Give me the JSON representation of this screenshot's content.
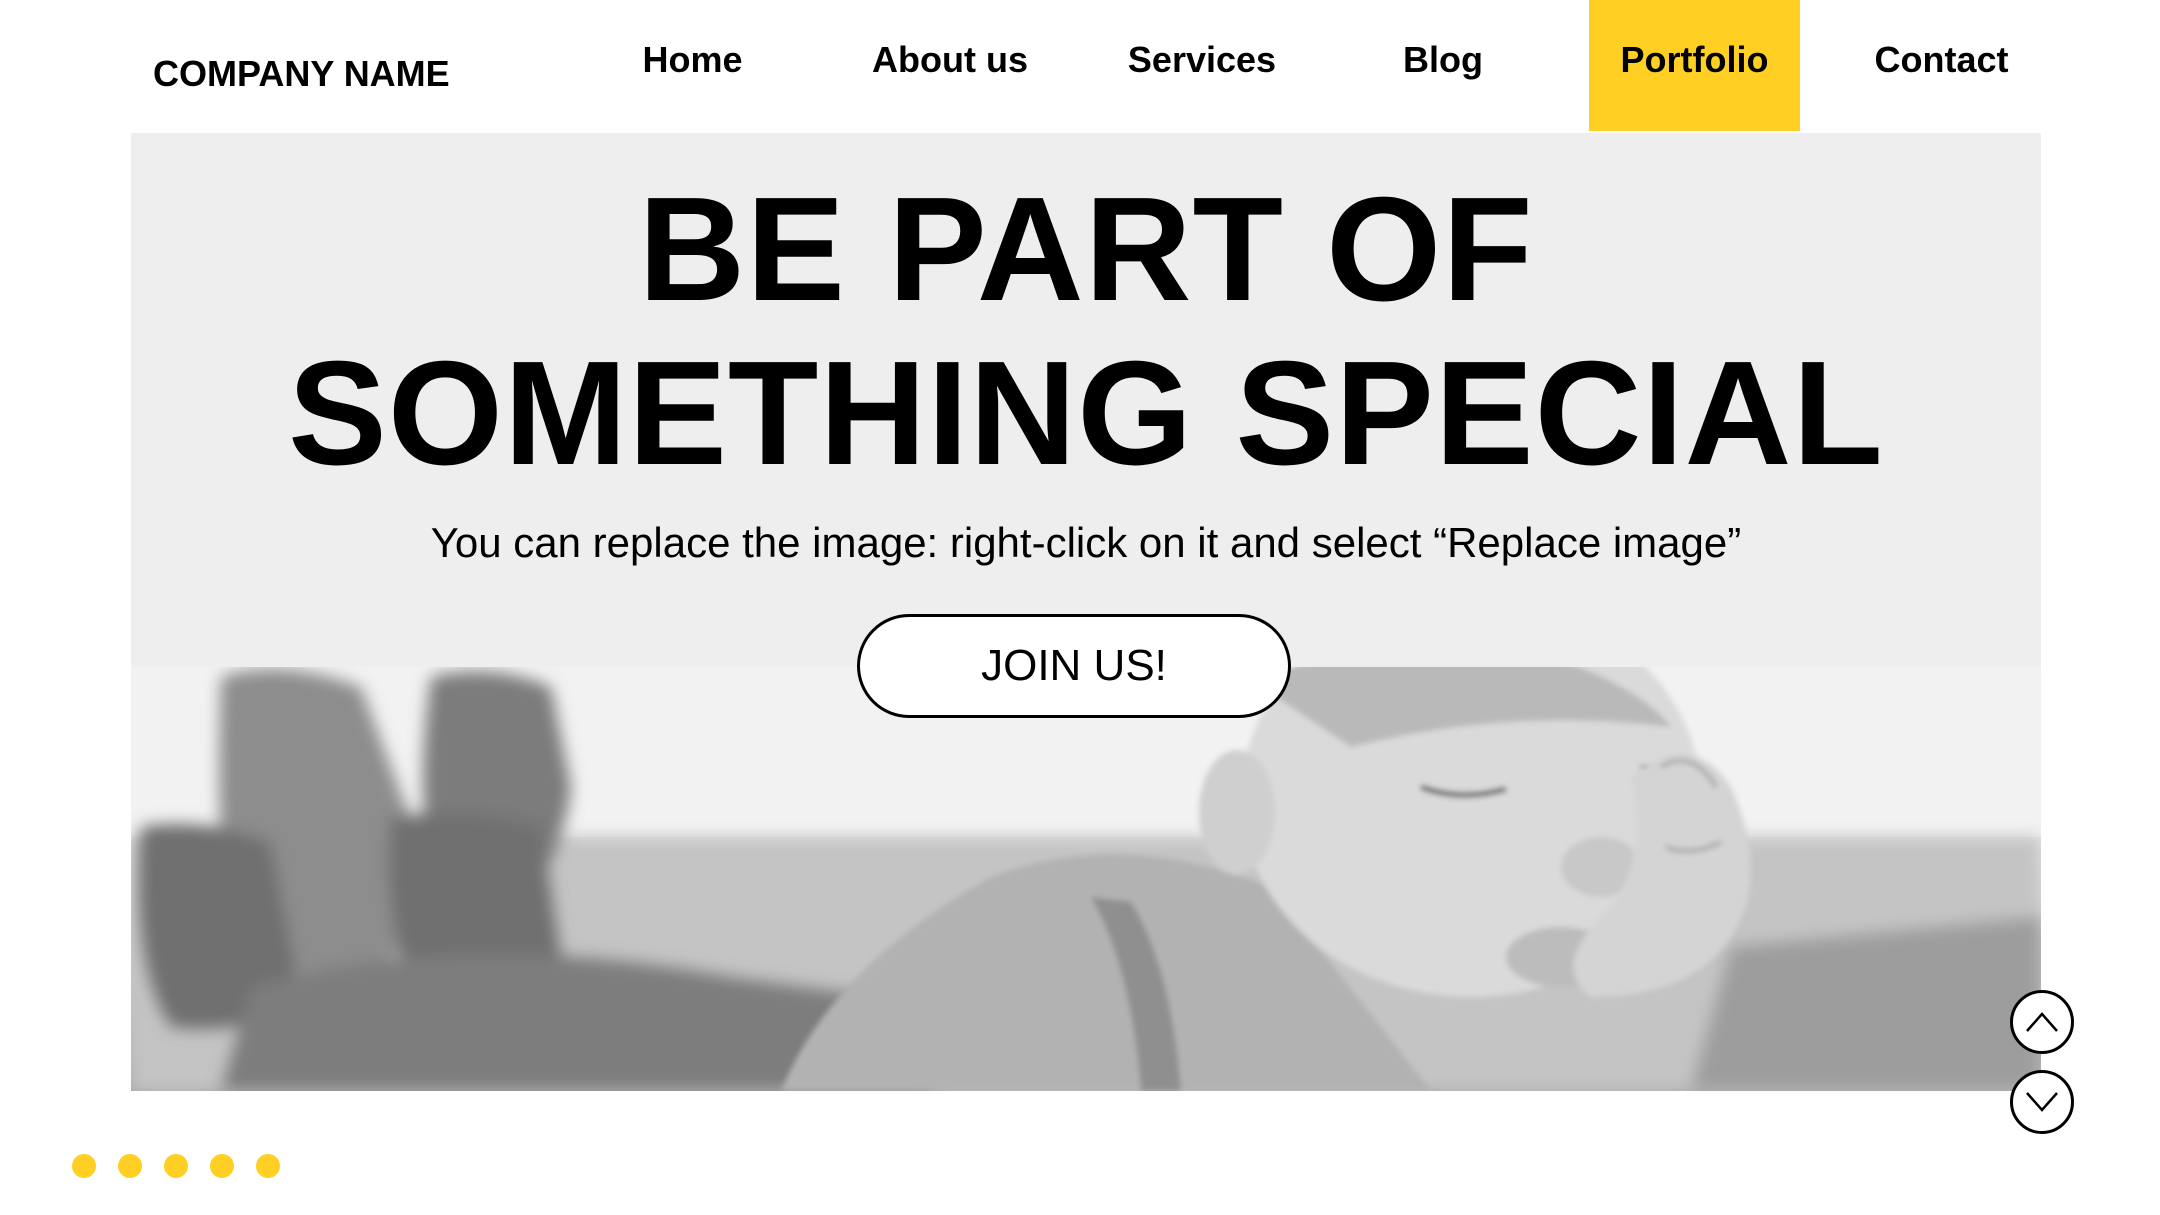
{
  "header": {
    "company_name": "COMPANY NAME",
    "nav": [
      {
        "label": "Home"
      },
      {
        "label": "About us"
      },
      {
        "label": "Services"
      },
      {
        "label": "Blog"
      },
      {
        "label": "Portfolio",
        "active": true
      },
      {
        "label": "Contact"
      }
    ]
  },
  "hero": {
    "headline_line1": "BE PART OF",
    "headline_line2": "SOMETHING SPECIAL",
    "subtitle": "You can replace the image: right-click on it and select “Replace image”",
    "cta_label": "JOIN US!"
  },
  "scroll_controls": {
    "up_icon": "chevron-up-icon",
    "down_icon": "chevron-down-icon"
  },
  "pagination": {
    "count": 5
  },
  "colors": {
    "accent": "#ffcf24",
    "hero_bg": "#eeeeee"
  }
}
